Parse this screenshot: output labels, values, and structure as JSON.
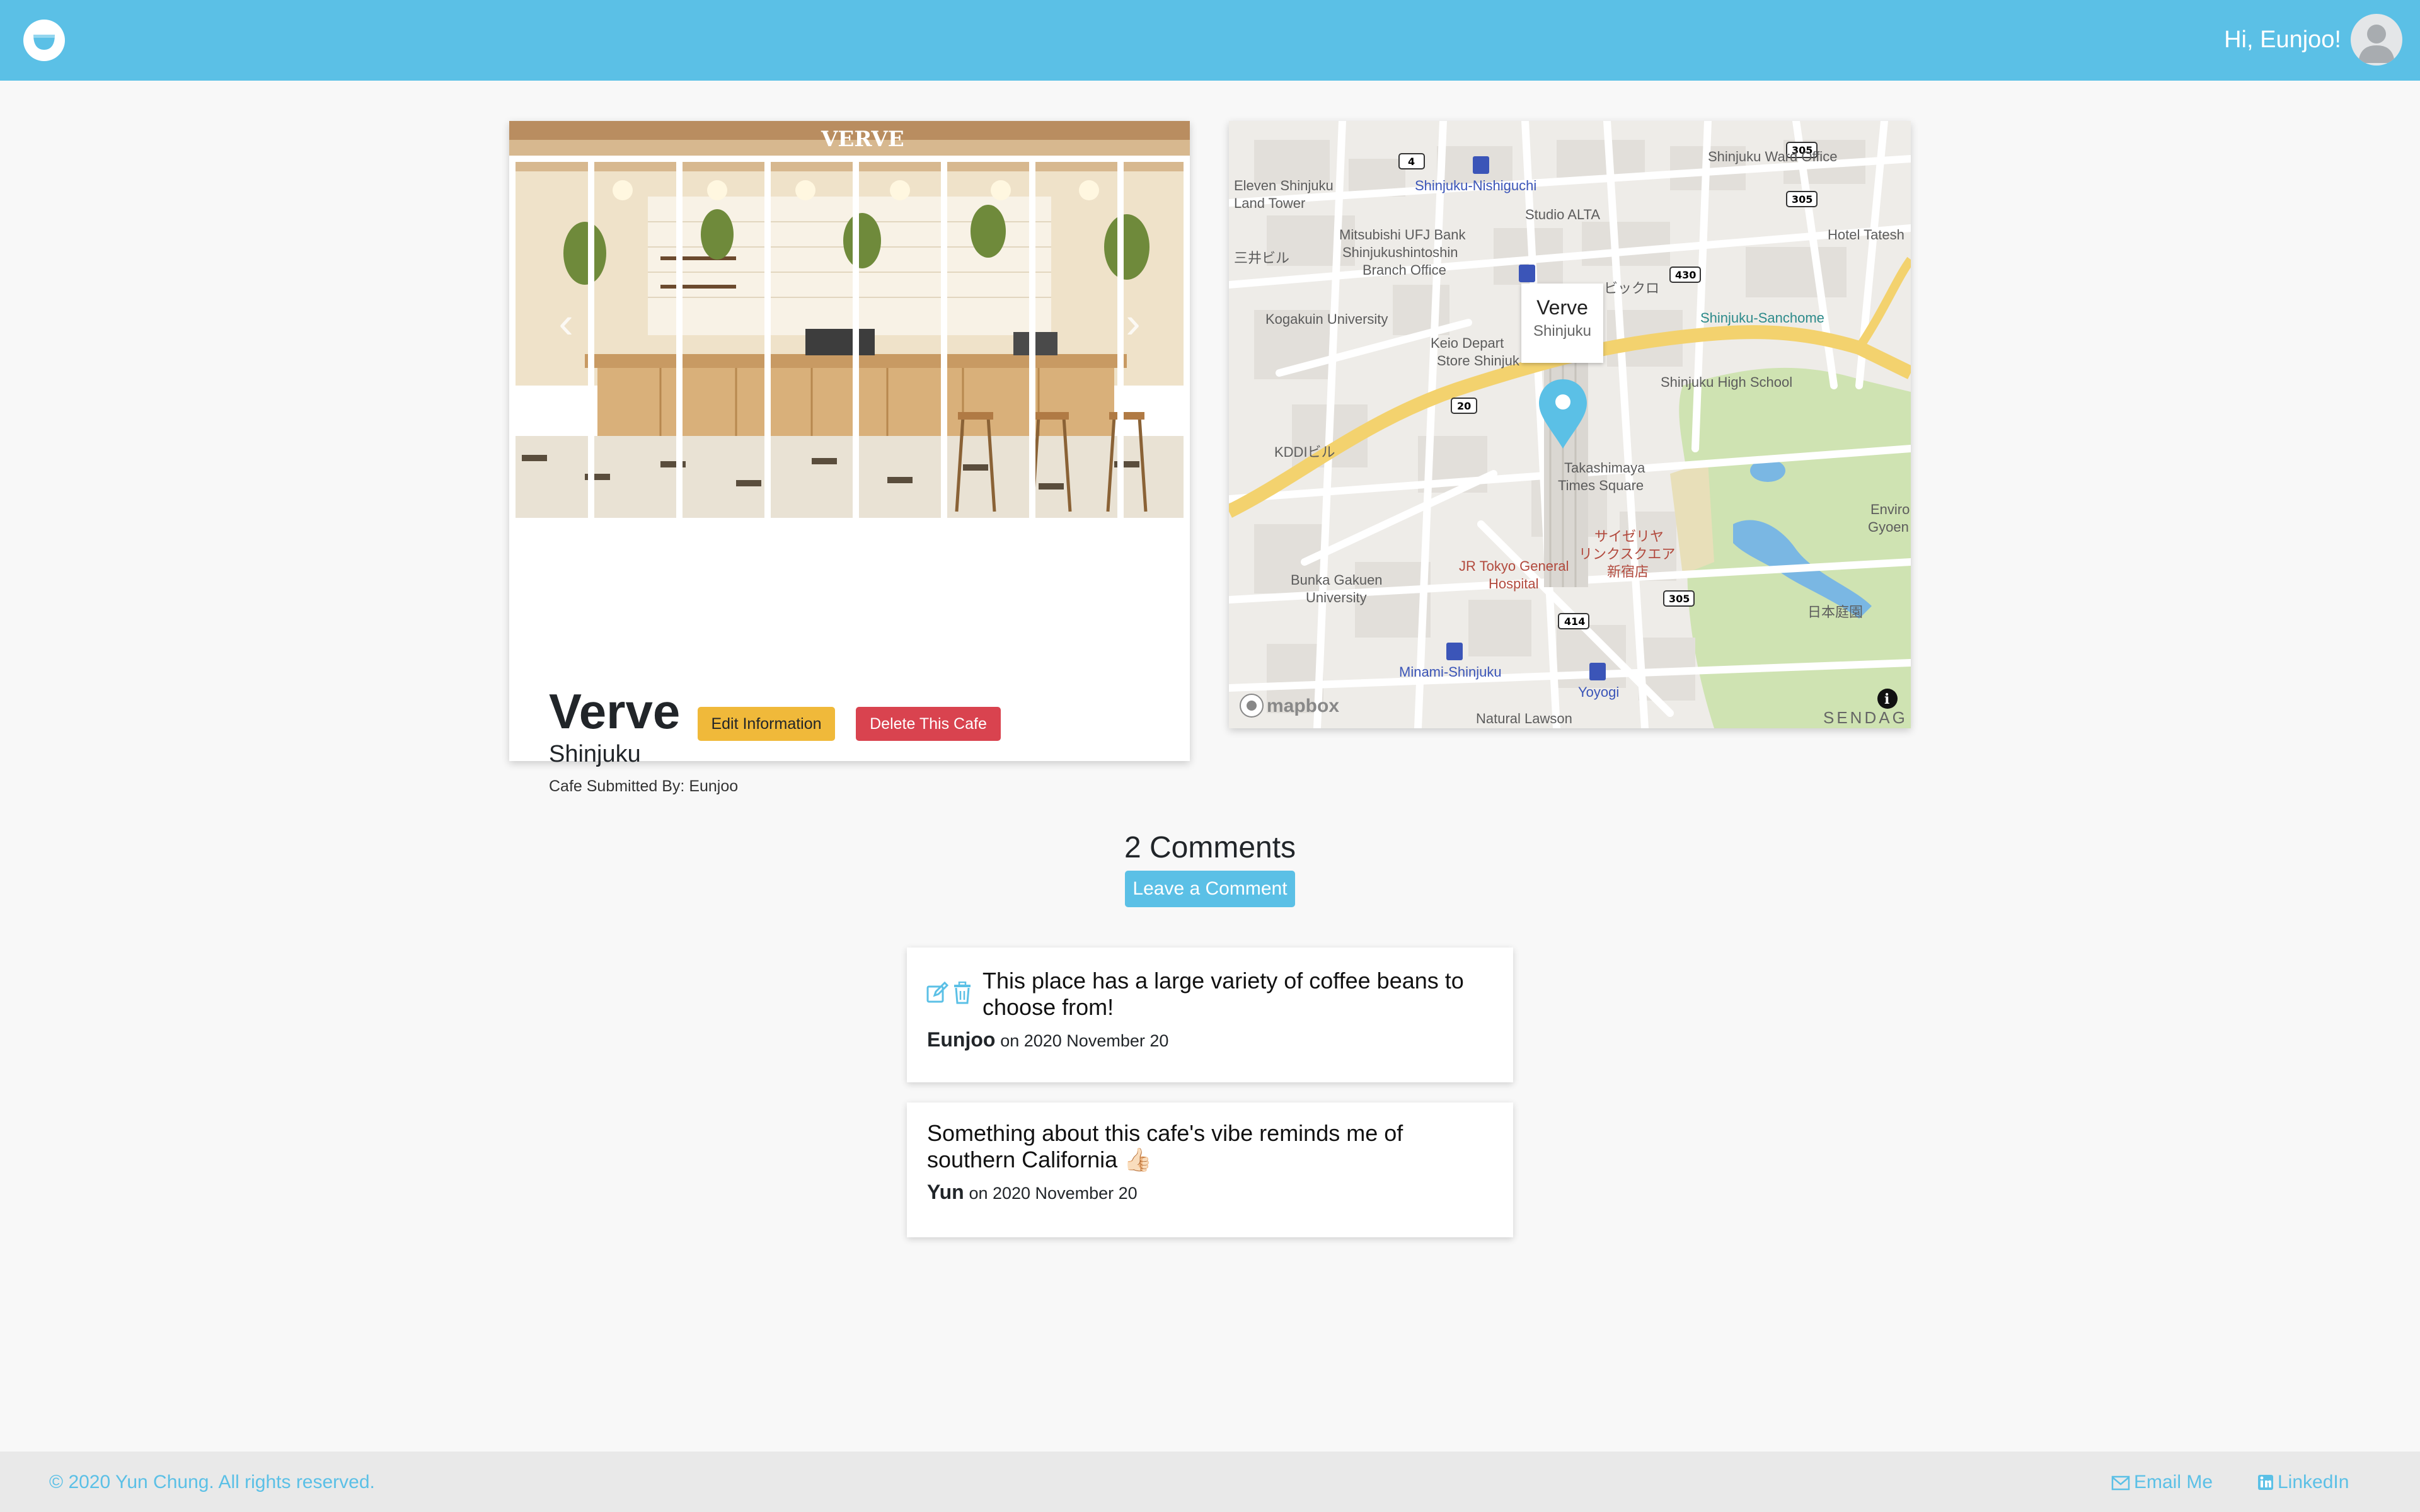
{
  "header": {
    "greeting": "Hi, Eunjoo!",
    "logo_icon": "coffee-cup-icon",
    "avatar_icon": "user-avatar-icon",
    "brand_color": "#5bc0e6"
  },
  "cafe": {
    "name": "Verve",
    "area": "Shinjuku",
    "submitted_by": "Cafe Submitted By: Eunjoo",
    "edit_label": "Edit Information",
    "delete_label": "Delete This Cafe",
    "photo_sign": "VERVE",
    "edit_color": "#f0b93a",
    "delete_color": "#d9434f"
  },
  "map": {
    "popup_title": "Verve",
    "popup_subtitle": "Shinjuku",
    "attribution": "mapbox",
    "corner_text": "SENDAG",
    "labels": [
      {
        "text": "Shinjuku Ward Office",
        "cls": ""
      },
      {
        "text": "Shinjuku-Nishiguchi",
        "cls": "blue"
      },
      {
        "text": "Eleven Shinjuku",
        "cls": ""
      },
      {
        "text": "Land Tower",
        "cls": ""
      },
      {
        "text": "Studio ALTA",
        "cls": ""
      },
      {
        "text": "Mitsubishi UFJ Bank",
        "cls": ""
      },
      {
        "text": "Shinjukushintoshin",
        "cls": ""
      },
      {
        "text": "Branch Office",
        "cls": ""
      },
      {
        "text": "三井ビル",
        "cls": ""
      },
      {
        "text": "Hotel Tatesh",
        "cls": ""
      },
      {
        "text": "ビックロ",
        "cls": ""
      },
      {
        "text": "Kogakuin University",
        "cls": ""
      },
      {
        "text": "Keio Depart",
        "cls": ""
      },
      {
        "text": "Store Shinjuk",
        "cls": ""
      },
      {
        "text": "Shinjuku-Sanchome",
        "cls": "teal"
      },
      {
        "text": "Shinjuku High School",
        "cls": ""
      },
      {
        "text": "KDDIビル",
        "cls": ""
      },
      {
        "text": "Takashimaya",
        "cls": ""
      },
      {
        "text": "Times Square",
        "cls": ""
      },
      {
        "text": "サイゼリヤ",
        "cls": "red"
      },
      {
        "text": "リンクスクエア",
        "cls": "red"
      },
      {
        "text": "新宿店",
        "cls": "red"
      },
      {
        "text": "JR Tokyo General",
        "cls": "red"
      },
      {
        "text": "Hospital",
        "cls": "red"
      },
      {
        "text": "Bunka Gakuen",
        "cls": ""
      },
      {
        "text": "University",
        "cls": ""
      },
      {
        "text": "日本庭園",
        "cls": ""
      },
      {
        "text": "Minami-Shinjuku",
        "cls": "blue"
      },
      {
        "text": "Yoyogi",
        "cls": "blue"
      },
      {
        "text": "Natural Lawson",
        "cls": ""
      },
      {
        "text": "Enviro",
        "cls": ""
      },
      {
        "text": "Gyoen",
        "cls": ""
      }
    ],
    "shields": [
      "4",
      "305",
      "305",
      "430",
      "20",
      "414",
      "305"
    ]
  },
  "comments": {
    "heading": "2 Comments",
    "leave_label": "Leave a Comment",
    "items": [
      {
        "text": "This place has a large variety of coffee beans to choose from!",
        "author": "Eunjoo",
        "date": "on 2020 November 20"
      },
      {
        "text": "Something about this cafe's vibe reminds me of southern California 👍🏻",
        "author": "Yun",
        "date": "on 2020 November 20"
      }
    ]
  },
  "footer": {
    "copyright": "© 2020 Yun Chung. All rights reserved.",
    "email_label": "Email Me",
    "linkedin_label": "LinkedIn"
  }
}
